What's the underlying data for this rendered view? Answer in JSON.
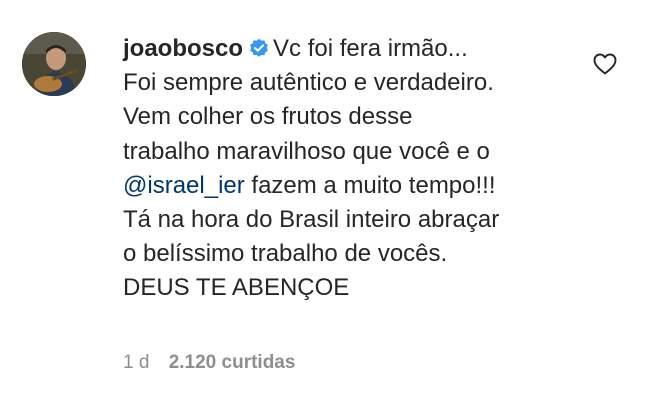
{
  "comment": {
    "username": "joaobosco",
    "verified_icon": "verified-badge-icon",
    "text_line_1": "Vc foi fera irmão...",
    "text_line_2": "Foi sempre autêntico e verdadeiro.",
    "text_line_3": "Vem colher os frutos desse",
    "text_line_4": "trabalho maravilhoso que você e o",
    "mention": "@israel_ier",
    "text_line_5_rest": " fazem a muito tempo!!!",
    "text_line_6": "Tá na hora do Brasil inteiro abraçar",
    "text_line_7": "o belíssimo trabalho de vocês.",
    "text_line_8": "DEUS TE ABENÇOE",
    "time_ago": "1 d",
    "likes": "2.120 curtidas",
    "like_icon": "heart-outline-icon",
    "avatar_icon": "profile-avatar"
  },
  "colors": {
    "text": "#262626",
    "mention": "#00376b",
    "meta": "#8e8e8e",
    "verified": "#3897f0"
  }
}
